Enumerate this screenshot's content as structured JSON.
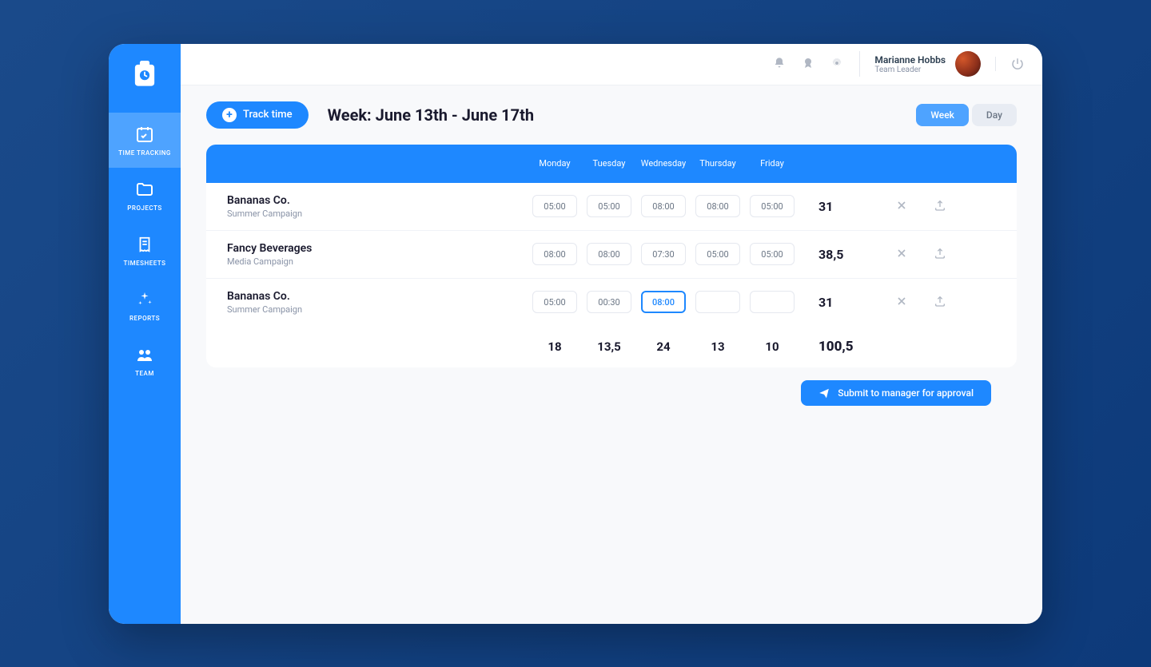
{
  "sidebar": {
    "items": [
      {
        "label": "TIME TRACKING"
      },
      {
        "label": "PROJECTS"
      },
      {
        "label": "TIMESHEETS"
      },
      {
        "label": "REPORTS"
      },
      {
        "label": "TEAM"
      }
    ]
  },
  "topbar": {
    "user_name": "Marianne Hobbs",
    "user_role": "Team Leader"
  },
  "toolbar": {
    "track_label": "Track time",
    "page_title": "Week: June 13th - June 17th",
    "week_label": "Week",
    "day_label": "Day"
  },
  "table": {
    "days": [
      "Monday",
      "Tuesday",
      "Wednesday",
      "Thursday",
      "Friday"
    ],
    "rows": [
      {
        "project": "Bananas Co.",
        "sub": "Summer Campaign",
        "cells": [
          "05:00",
          "05:00",
          "08:00",
          "08:00",
          "05:00"
        ],
        "focus": -1,
        "total": "31"
      },
      {
        "project": "Fancy Beverages",
        "sub": "Media Campaign",
        "cells": [
          "08:00",
          "08:00",
          "07:30",
          "05:00",
          "05:00"
        ],
        "focus": -1,
        "total": "38,5"
      },
      {
        "project": "Bananas Co.",
        "sub": "Summer Campaign",
        "cells": [
          "05:00",
          "00:30",
          "08:00",
          "",
          ""
        ],
        "focus": 2,
        "total": "31"
      }
    ],
    "footer": [
      "18",
      "13,5",
      "24",
      "13",
      "10"
    ],
    "grand_total": "100,5"
  },
  "submit": {
    "label": "Submit to manager for approval"
  }
}
